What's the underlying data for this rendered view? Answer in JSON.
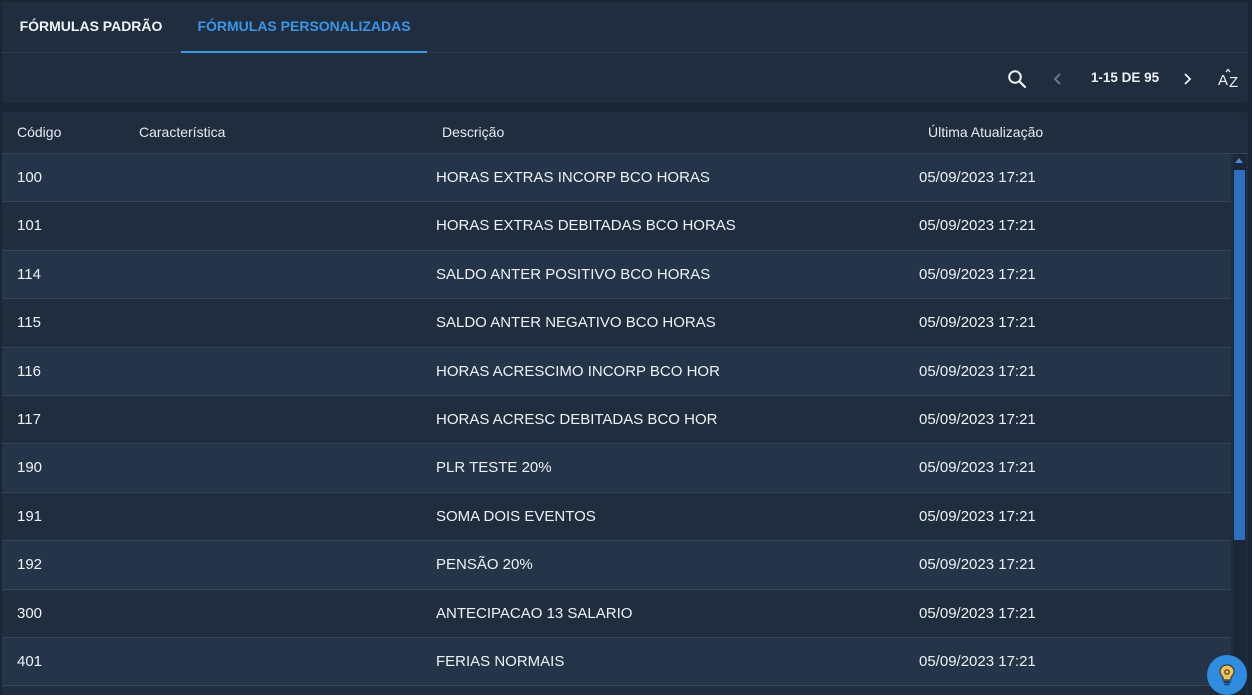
{
  "tabs": [
    {
      "label": "FÓRMULAS PADRÃO",
      "active": false
    },
    {
      "label": "FÓRMULAS PERSONALIZADAS",
      "active": true
    }
  ],
  "toolbar": {
    "search_icon": "search-icon",
    "prev_icon": "chevron-left-icon",
    "next_icon": "chevron-right-icon",
    "sort_icon": "sort-az-icon",
    "pagination": "1-15 DE 95"
  },
  "table": {
    "headers": [
      "Código",
      "Característica",
      "Descrição",
      "Última Atualização"
    ],
    "rows": [
      {
        "code": "100",
        "characteristic": "",
        "description": "HORAS EXTRAS INCORP BCO HORAS",
        "updated": "05/09/2023 17:21"
      },
      {
        "code": "101",
        "characteristic": "",
        "description": "HORAS EXTRAS DEBITADAS BCO HORAS",
        "updated": "05/09/2023 17:21"
      },
      {
        "code": "114",
        "characteristic": "",
        "description": "SALDO ANTER POSITIVO BCO HORAS",
        "updated": "05/09/2023 17:21"
      },
      {
        "code": "115",
        "characteristic": "",
        "description": "SALDO ANTER NEGATIVO BCO HORAS",
        "updated": "05/09/2023 17:21"
      },
      {
        "code": "116",
        "characteristic": "",
        "description": "HORAS ACRESCIMO INCORP BCO HOR",
        "updated": "05/09/2023 17:21"
      },
      {
        "code": "117",
        "characteristic": "",
        "description": "HORAS ACRESC DEBITADAS BCO HOR",
        "updated": "05/09/2023 17:21"
      },
      {
        "code": "190",
        "characteristic": "",
        "description": "PLR TESTE 20%",
        "updated": "05/09/2023 17:21"
      },
      {
        "code": "191",
        "characteristic": "",
        "description": "SOMA DOIS EVENTOS",
        "updated": "05/09/2023 17:21"
      },
      {
        "code": "192",
        "characteristic": "",
        "description": "PENSÃO 20%",
        "updated": "05/09/2023 17:21"
      },
      {
        "code": "300",
        "characteristic": "",
        "description": "ANTECIPACAO 13 SALARIO",
        "updated": "05/09/2023 17:21"
      },
      {
        "code": "401",
        "characteristic": "",
        "description": "FERIAS NORMAIS",
        "updated": "05/09/2023 17:21"
      }
    ]
  },
  "help_button": {
    "icon": "lightbulb-icon"
  },
  "colors": {
    "background": "#1b2635",
    "card": "#1f2d3f",
    "row_alt": "#243549",
    "accent": "#3b96e8",
    "scrollbar": "#2f6fc0"
  }
}
